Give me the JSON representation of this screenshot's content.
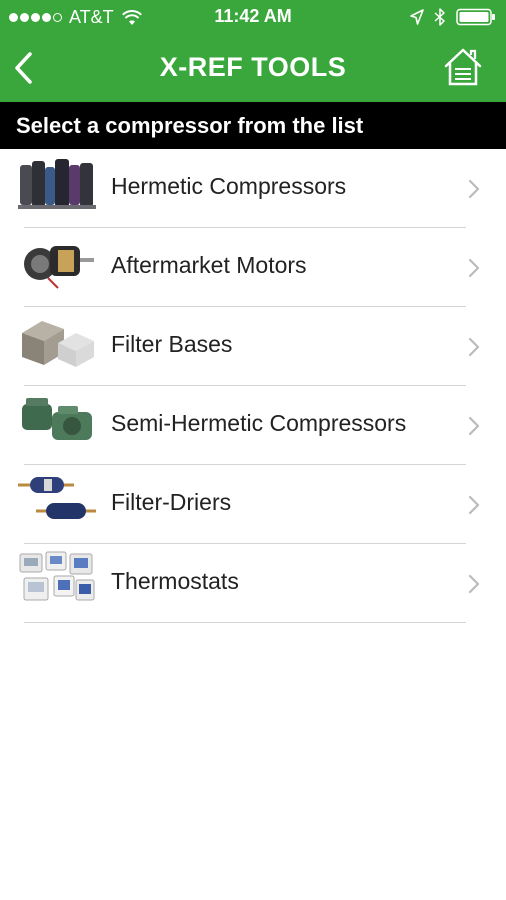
{
  "status_bar": {
    "carrier": "AT&T",
    "time": "11:42 AM",
    "signal_dots_filled": 4,
    "icons": [
      "wifi-icon",
      "location-arrow-icon",
      "bluetooth-icon",
      "battery-icon"
    ]
  },
  "nav": {
    "title": "X-REF TOOLS",
    "back_icon": "chevron-left-icon",
    "home_icon": "home-icon"
  },
  "banner": "Select a compressor from the list",
  "items": [
    {
      "label": "Hermetic Compressors",
      "icon": "hermetic-compressors-thumbnail"
    },
    {
      "label": "Aftermarket Motors",
      "icon": "motor-thumbnail"
    },
    {
      "label": "Filter Bases",
      "icon": "filter-base-thumbnail"
    },
    {
      "label": "Semi-Hermetic Compressors",
      "icon": "semi-hermetic-compressor-thumbnail"
    },
    {
      "label": "Filter-Driers",
      "icon": "filter-drier-thumbnail"
    },
    {
      "label": "Thermostats",
      "icon": "thermostat-thumbnail"
    }
  ],
  "colors": {
    "header_green": "#3aa73c",
    "banner_black": "#000000",
    "text": "#222222",
    "chevron": "#bbbbbb"
  }
}
